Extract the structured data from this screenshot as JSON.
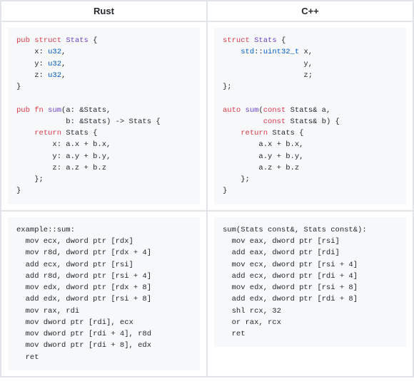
{
  "headers": {
    "left": "Rust",
    "right": "C++"
  },
  "rust_src": {
    "kw_pub1": "pub",
    "kw_struct": "struct",
    "name_Stats": "Stats",
    "brace_open": " {",
    "field_x": "    x: ",
    "u32_1": "u32",
    "comma1": ",",
    "field_y": "    y: ",
    "u32_2": "u32",
    "comma2": ",",
    "field_z": "    z: ",
    "u32_3": "u32",
    "comma3": ",",
    "brace_close1": "}",
    "blank1": "",
    "kw_pub2": "pub",
    "kw_fn": "fn",
    "fn_sum": "sum",
    "sig1": "(a: &Stats,",
    "sig2": "           b: &Stats) -> Stats {",
    "kw_return": "return",
    "ret1": " Stats {",
    "expr_x": "        x: a.x + b.x,",
    "expr_y": "        y: a.y + b.y,",
    "expr_z": "        z: a.z + b.z",
    "ret_close": "    };",
    "brace_close2": "}"
  },
  "cpp_src": {
    "kw_struct": "struct",
    "name_Stats": "Stats",
    "brace_open": " {",
    "std": "std",
    "cc": "::",
    "u32t": "uint32_t",
    "x": " x,",
    "y": "                  y,",
    "z": "                  z;",
    "brace_close1": "};",
    "blank1": "",
    "kw_auto": "auto",
    "fn_sum": "sum",
    "lp": "(",
    "kw_const1": "const",
    "arg1": " Stats& a,",
    "pad2": "         ",
    "kw_const2": "const",
    "arg2": " Stats& b) {",
    "kw_return": "return",
    "ret1": " Stats {",
    "expr_x": "        a.x + b.x,",
    "expr_y": "        a.y + b.y,",
    "expr_z": "        a.z + b.z",
    "ret_close": "    };",
    "brace_close2": "}"
  },
  "rust_asm": [
    "example::sum:",
    "  mov ecx, dword ptr [rdx]",
    "  mov r8d, dword ptr [rdx + 4]",
    "  add ecx, dword ptr [rsi]",
    "  add r8d, dword ptr [rsi + 4]",
    "  mov edx, dword ptr [rdx + 8]",
    "  add edx, dword ptr [rsi + 8]",
    "  mov rax, rdi",
    "  mov dword ptr [rdi], ecx",
    "  mov dword ptr [rdi + 4], r8d",
    "  mov dword ptr [rdi + 8], edx",
    "  ret"
  ],
  "cpp_asm": [
    "sum(Stats const&, Stats const&):",
    "  mov eax, dword ptr [rsi]",
    "  add eax, dword ptr [rdi]",
    "  mov ecx, dword ptr [rsi + 4]",
    "  add ecx, dword ptr [rdi + 4]",
    "  mov edx, dword ptr [rsi + 8]",
    "  add edx, dword ptr [rdi + 8]",
    "  shl rcx, 32",
    "  or rax, rcx",
    "  ret"
  ]
}
